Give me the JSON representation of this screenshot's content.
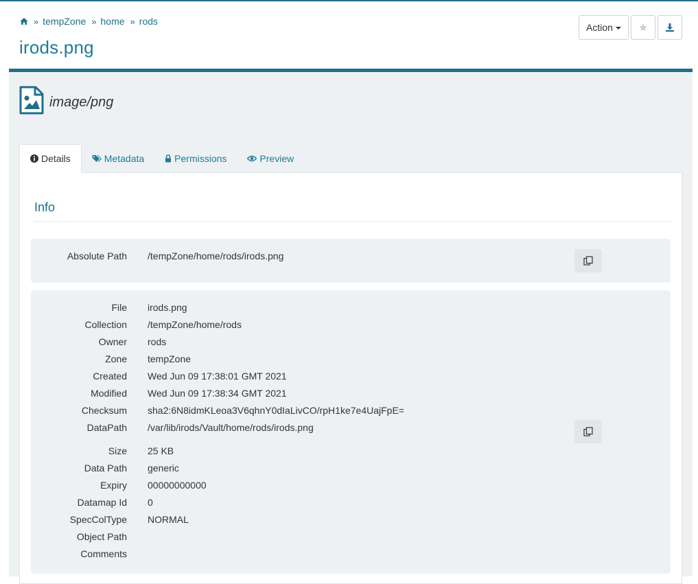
{
  "breadcrumb": [
    "tempZone",
    "home",
    "rods"
  ],
  "page_title": "irods.png",
  "actions": {
    "action_label": "Action"
  },
  "mime_type": "image/png",
  "tabs": [
    {
      "label": "Details",
      "icon": "info-circle-icon"
    },
    {
      "label": "Metadata",
      "icon": "tags-icon"
    },
    {
      "label": "Permissions",
      "icon": "lock-icon"
    },
    {
      "label": "Preview",
      "icon": "eye-icon"
    }
  ],
  "section_title": "Info",
  "absolute_path": {
    "label": "Absolute Path",
    "value": "/tempZone/home/rods/irods.png"
  },
  "details": [
    {
      "label": "File",
      "value": "irods.png"
    },
    {
      "label": "Collection",
      "value": "/tempZone/home/rods"
    },
    {
      "label": "Owner",
      "value": "rods"
    },
    {
      "label": "Zone",
      "value": "tempZone"
    },
    {
      "label": "Created",
      "value": "Wed Jun 09 17:38:01 GMT 2021"
    },
    {
      "label": "Modified",
      "value": "Wed Jun 09 17:38:34 GMT 2021"
    },
    {
      "label": "Checksum",
      "value": "sha2:6N8idmKLeoa3V6qhnY0dIaLivCO/rpH1ke7e4UajFpE="
    },
    {
      "label": "DataPath",
      "value": "/var/lib/irods/Vault/home/rods/irods.png"
    },
    {
      "label": "Size",
      "value": "25 KB"
    },
    {
      "label": "Data Path",
      "value": "generic"
    },
    {
      "label": "Expiry",
      "value": "00000000000"
    },
    {
      "label": "Datamap Id",
      "value": "0"
    },
    {
      "label": "SpecColType",
      "value": "NORMAL"
    },
    {
      "label": "Object Path",
      "value": ""
    },
    {
      "label": "Comments",
      "value": ""
    }
  ],
  "colors": {
    "accent": "#1f6f8b",
    "link": "#1f7a99",
    "panel_bg": "#eef1f3"
  }
}
